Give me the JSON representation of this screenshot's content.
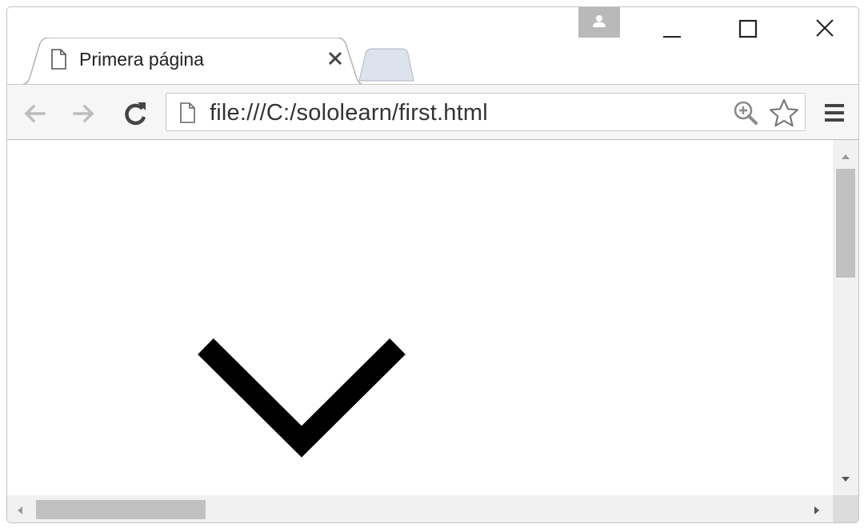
{
  "tab": {
    "title": "Primera página",
    "icon": "document-icon",
    "close_icon": "close-icon"
  },
  "window_controls": [
    "minimize-icon",
    "maximize-icon",
    "close-icon"
  ],
  "profile_icon": "person-icon",
  "toolbar": {
    "back_icon": "arrow-left-icon",
    "forward_icon": "arrow-right-icon",
    "reload_icon": "reload-icon",
    "url": "file:///C:/sololearn/first.html",
    "zoom_icon": "zoom-in-icon",
    "bookmark_icon": "star-icon",
    "menu_icon": "hamburger-icon"
  },
  "page": {
    "graphic": "chevron-down-shape"
  },
  "colors": {
    "tab_border": "#b3b3b3",
    "new_tab_fill": "#dde3ec",
    "toolbar_bg": "#f6f6f6",
    "scrollbar_track": "#f1f1f1",
    "scrollbar_thumb": "#c1c1c1",
    "graphic": "#000000"
  }
}
